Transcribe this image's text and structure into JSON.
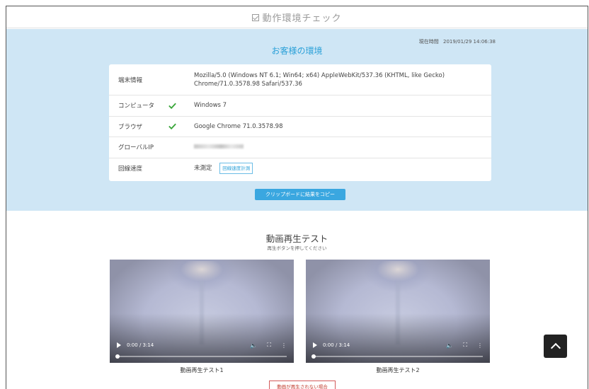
{
  "header": {
    "title": "動作環境チェック"
  },
  "env": {
    "title": "お客様の環境",
    "current_time_label": "現在時間",
    "current_time": "2019/01/29 14:06:38",
    "rows": [
      {
        "key": "端末情報",
        "value": "Mozilla/5.0 (Windows NT 6.1; Win64; x64) AppleWebKit/537.36 (KHTML, like Gecko) Chrome/71.0.3578.98 Safari/537.36",
        "check": false
      },
      {
        "key": "コンピュータ",
        "value": "Windows 7",
        "check": true
      },
      {
        "key": "ブラウザ",
        "value": "Google Chrome 71.0.3578.98",
        "check": true
      },
      {
        "key": "グローバルIP",
        "value": "",
        "check": false
      },
      {
        "key": "回線速度",
        "value": "未測定",
        "check": false
      }
    ],
    "speed_button": "回線速度計測",
    "copy_button": "クリップボードに結果をコピー"
  },
  "video": {
    "title": "動画再生テスト",
    "subtitle": "再生ボタンを押してください",
    "players": [
      {
        "time": "0:00 / 3:14",
        "progress": 0,
        "caption": "動画再生テスト1"
      },
      {
        "time": "0:00 / 3:14",
        "progress": 0,
        "caption": "動画再生テスト2"
      }
    ],
    "warn_button": "動画が再生されない場合"
  },
  "colors": {
    "accent": "#2aa0d8",
    "env_bg": "#cfe6f5",
    "check": "#3aa63a",
    "warn": "#c0392b"
  },
  "icons": [
    "checkbox-icon",
    "check-icon",
    "play-icon",
    "volume-icon",
    "fullscreen-icon",
    "more-icon",
    "chevron-up-icon"
  ]
}
